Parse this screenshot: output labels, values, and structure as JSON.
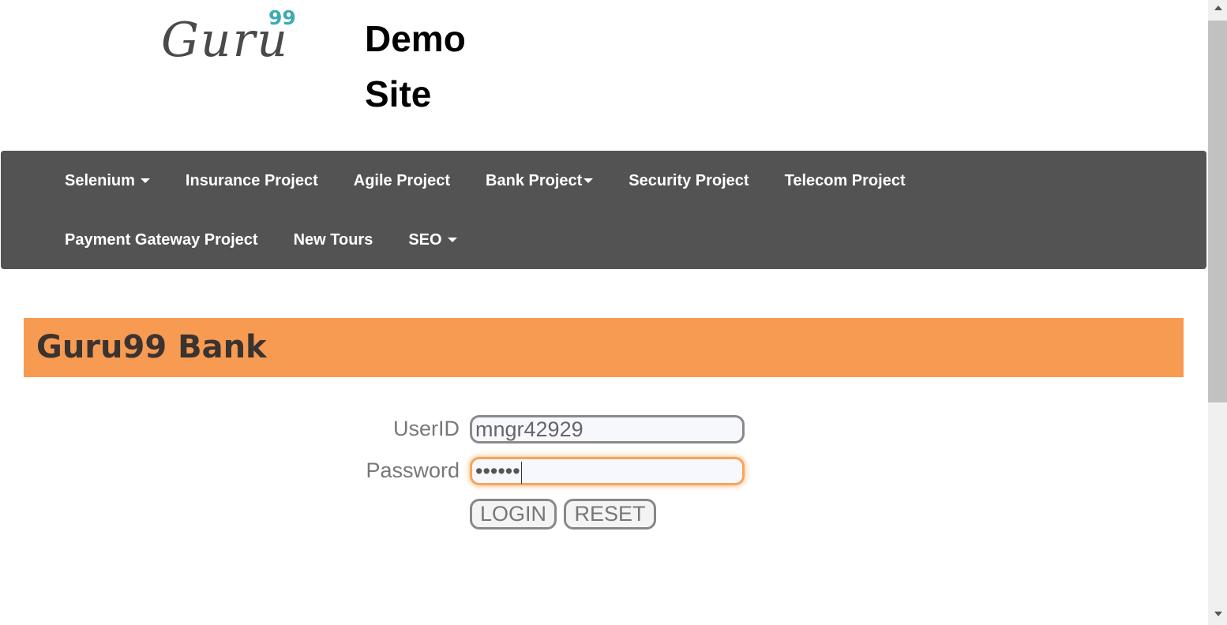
{
  "logo": {
    "main": "Guru",
    "superscript": "99"
  },
  "site_title": "Demo Site",
  "nav": {
    "row1": [
      {
        "label": "Selenium",
        "dropdown": true
      },
      {
        "label": "Insurance Project",
        "dropdown": false
      },
      {
        "label": "Agile Project",
        "dropdown": false
      },
      {
        "label": "Bank Project",
        "dropdown": true
      },
      {
        "label": "Security Project",
        "dropdown": false
      },
      {
        "label": "Telecom Project",
        "dropdown": false
      }
    ],
    "row2": [
      {
        "label": "Payment Gateway Project",
        "dropdown": false
      },
      {
        "label": "New Tours",
        "dropdown": false
      },
      {
        "label": "SEO",
        "dropdown": true
      }
    ]
  },
  "bank_header": {
    "title": "Guru99 Bank",
    "color": "#f79a52"
  },
  "login_form": {
    "userid_label": "UserID",
    "userid_value": "mngr42929",
    "password_label": "Password",
    "password_value": "••••••",
    "login_button": "LOGIN",
    "reset_button": "RESET"
  },
  "colors": {
    "navbar": "#535353",
    "accent_teal": "#3fa9b5",
    "focus_orange": "#f5a65b"
  }
}
